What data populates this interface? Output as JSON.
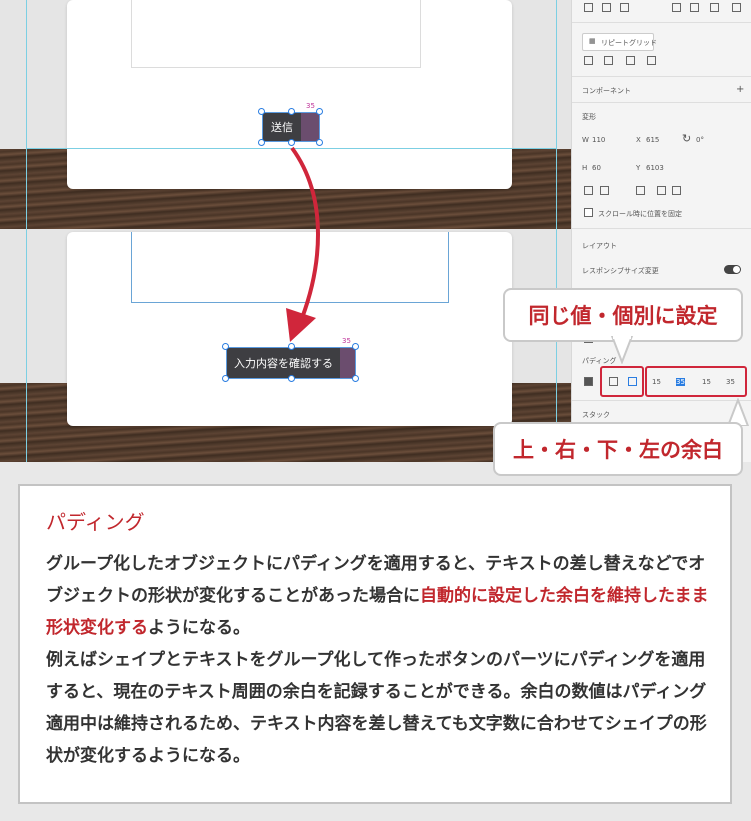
{
  "canvas": {
    "button_top_label": "送信",
    "button_bottom_label": "入力内容を確認する",
    "size_tag": "35"
  },
  "panel": {
    "repeat_grid_label": "リピートグリッド",
    "component_label": "コンポーネント",
    "transform_label": "変形",
    "w_label": "W",
    "w_value": "110",
    "x_label": "X",
    "x_value": "615",
    "rotation_value": "0°",
    "h_label": "H",
    "h_value": "60",
    "y_label": "Y",
    "y_value": "6103",
    "fix_scroll_label": "スクロール時に位置を固定",
    "layout_label": "レイアウト",
    "responsive_label": "レスポンシブサイズ変更",
    "padding_label": "パディング",
    "padding_values": [
      "15",
      "35",
      "15",
      "35"
    ],
    "stack_label": "スタック",
    "percent_label": "%"
  },
  "callouts": {
    "same_or_individual": "同じ値・個別に設定",
    "sides": "上・右・下・左の余白"
  },
  "info": {
    "title": "パディング",
    "para1_a": "グループ化したオブジェクトにパディングを適用すると、テキストの差し替えなどでオブジェクトの形状が変化することがあった場合に",
    "para1_highlight": "自動的に設定した余白を維持したまま形状変化する",
    "para1_b": "ようになる。",
    "para2": "例えばシェイプとテキストをグループ化して作ったボタンのパーツにパディングを適用すると、現在のテキスト周囲の余白を記録することができる。余白の数値はパディング適用中は維持されるため、テキスト内容を差し替えても文字数に合わせてシェイプの形状が変化するようになる。"
  },
  "colors": {
    "accent": "#c1272d",
    "selection": "#2a7de1",
    "padding_fill": "#6b4d6e"
  }
}
